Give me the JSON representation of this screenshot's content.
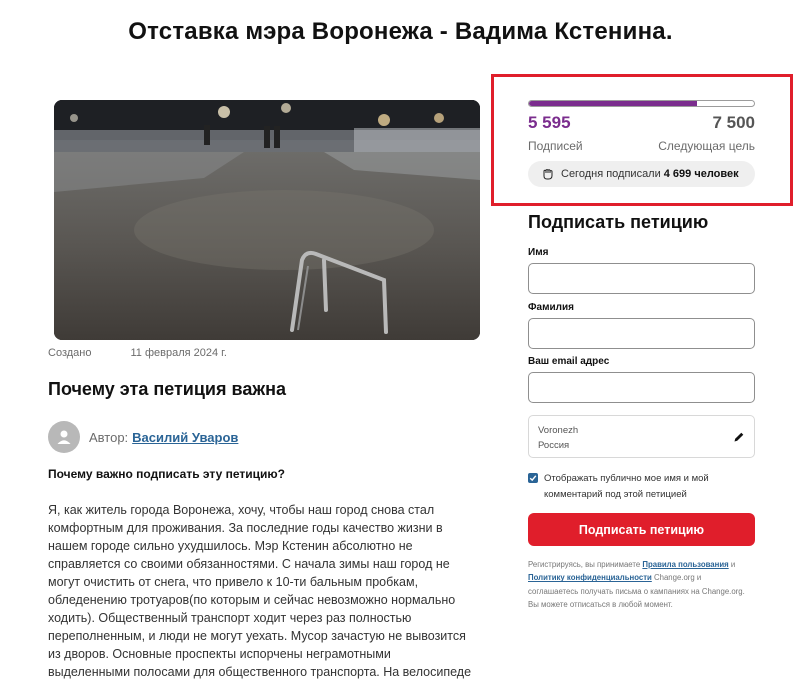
{
  "page": {
    "title": "Отставка мэра Воронежа - Вадима Кстенина."
  },
  "meta": {
    "created_label": "Создано",
    "created_date": "11 февраля 2024 г."
  },
  "story": {
    "heading": "Почему эта петиция важна",
    "author_label": "Автор:",
    "author_name": "Василий Уваров",
    "question": "Почему важно подписать эту петицию?",
    "lines": [
      "Я, как житель города Воронежа, хочу, чтобы наш город снова стал",
      "комфортным для проживания. За последние годы качество жизни в",
      "нашем городе сильно ухудшилось. Мэр Кстенин абсолютно не",
      "справляется со своими обязанностями. С начала зимы наш город не",
      "могут очистить  от снега, что привело к 10-ти бальным пробкам,",
      "обледенению тротуаров(по которым и сейчас невозможно нормально",
      "ходить). Общественный транспорт ходит через раз полностью",
      "переполненным, и люди не могут уехать. Мусор зачастую не вывозится",
      "из дворов. Основные проспекты испорчены неграмотными",
      "выделенными полосами для общественного транспорта. На велосипеде"
    ]
  },
  "signatures": {
    "count": "5 595",
    "goal": "7 500",
    "progress_fraction": 0.746,
    "count_label": "Подписей",
    "goal_label": "Следующая цель",
    "today_prefix": "Сегодня подписали",
    "today_count": "4 699 человек",
    "accent_color": "#7b2d8e"
  },
  "form": {
    "heading": "Подписать петицию",
    "first_name_label": "Имя",
    "last_name_label": "Фамилия",
    "email_label": "Ваш email адрес",
    "first_name_value": "",
    "last_name_value": "",
    "email_value": "",
    "city": "Voronezh",
    "country": "Россия",
    "public_text_line1": "Отображать публично мое имя и мой",
    "public_text_line2": "комментарий под этой петицией",
    "submit_label": "Подписать петицию",
    "submit_color": "#e01e2b"
  },
  "legal": {
    "line1_prefix": "Регистрируясь, вы принимаете",
    "terms_link": "Правила пользования",
    "line1_and": "и",
    "privacy_link": "Политику конфиденциальности",
    "line2_suffix": "Change.org и",
    "line3": "соглашаетесь получать письма о кампаниях на Change.org.",
    "line4": "Вы можете отписаться в любой момент."
  },
  "icons": {
    "avatar": "user-avatar-icon",
    "hand": "fist-hand-icon",
    "edit": "pencil-icon",
    "check": "checkmark-icon"
  }
}
